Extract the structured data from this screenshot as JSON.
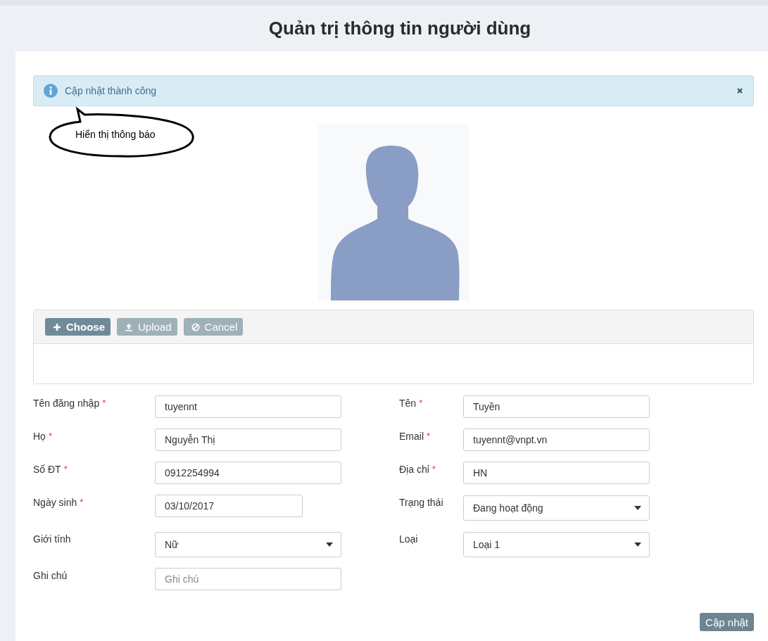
{
  "page": {
    "title": "Quản trị thông tin người dùng"
  },
  "alert": {
    "message": "Cập nhật thành công"
  },
  "callout": {
    "text": "Hiển thị thông báo"
  },
  "upload": {
    "buttons": [
      {
        "label": "Choose",
        "kind": "choose",
        "disabled": false
      },
      {
        "label": "Upload",
        "kind": "upload",
        "disabled": true
      },
      {
        "label": "Cancel",
        "kind": "cancel",
        "disabled": true
      }
    ]
  },
  "fields": [
    {
      "label": "Tên đăng nhập",
      "required_mark": "*",
      "kind": "text",
      "value": "tuyennt"
    },
    {
      "label": "Tên",
      "required_mark": "*",
      "kind": "text",
      "value": "Tuyền"
    },
    {
      "label": "Họ",
      "required_mark": "*",
      "kind": "text",
      "value": "Nguyễn Thị"
    },
    {
      "label": "Email",
      "required_mark": "*",
      "kind": "text",
      "value": "tuyennt@vnpt.vn"
    },
    {
      "label": "Số ĐT",
      "required_mark": "*",
      "kind": "text",
      "value": "0912254994"
    },
    {
      "label": "Địa chỉ",
      "required_mark": "*",
      "kind": "text",
      "value": "HN"
    },
    {
      "label": "Ngày sinh",
      "required_mark": "*",
      "kind": "date",
      "value": "03/10/2017"
    },
    {
      "label": "Trạng thái",
      "kind": "select",
      "value": "Đang hoạt động"
    },
    {
      "label": "Giới tính",
      "kind": "select",
      "value": "Nữ"
    },
    {
      "label": "Loại",
      "kind": "select",
      "value": "Loại 1"
    },
    {
      "label": "Ghi chú",
      "kind": "text",
      "placeholder": "Ghi chú"
    }
  ],
  "submit": {
    "label": "Cập nhật"
  }
}
